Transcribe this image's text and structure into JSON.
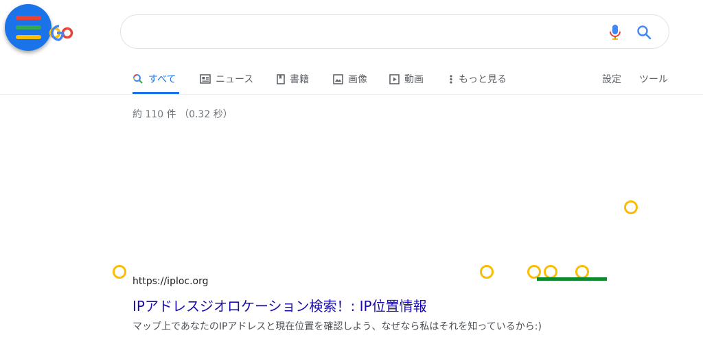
{
  "menu": {
    "icon": "hamburger-menu-icon",
    "bar_colors": [
      "#ea4335",
      "#34a853",
      "#fbbc04"
    ]
  },
  "logo": {
    "text": "ooG"
  },
  "search": {
    "value": "",
    "placeholder": "",
    "mic_icon": "mic-icon",
    "search_icon": "search-icon"
  },
  "tabs": [
    {
      "label": "すべて",
      "icon": "search-icon",
      "active": true
    },
    {
      "label": "ニュース",
      "icon": "news-icon"
    },
    {
      "label": "書籍",
      "icon": "book-icon"
    },
    {
      "label": "画像",
      "icon": "image-icon"
    },
    {
      "label": "動画",
      "icon": "video-icon"
    },
    {
      "label": "もっと見る",
      "icon": "more-vert-icon"
    }
  ],
  "tools": {
    "settings": "設定",
    "tools": "ツール"
  },
  "result_stats": "約 110 件 （0.32 秒）",
  "result": {
    "url": "https://iploc.org",
    "title": "IPアドレスジオロケーション検索！: IP位置情報",
    "snippet": "マップ上であなたのIPアドレスと現在位置を確認しよう、なぜなら私はそれを知っているから:)"
  },
  "colors": {
    "accent": "#1a73e8",
    "link": "#1a0dab",
    "ring": "#fbbc04",
    "green": "#0d8a2e"
  }
}
